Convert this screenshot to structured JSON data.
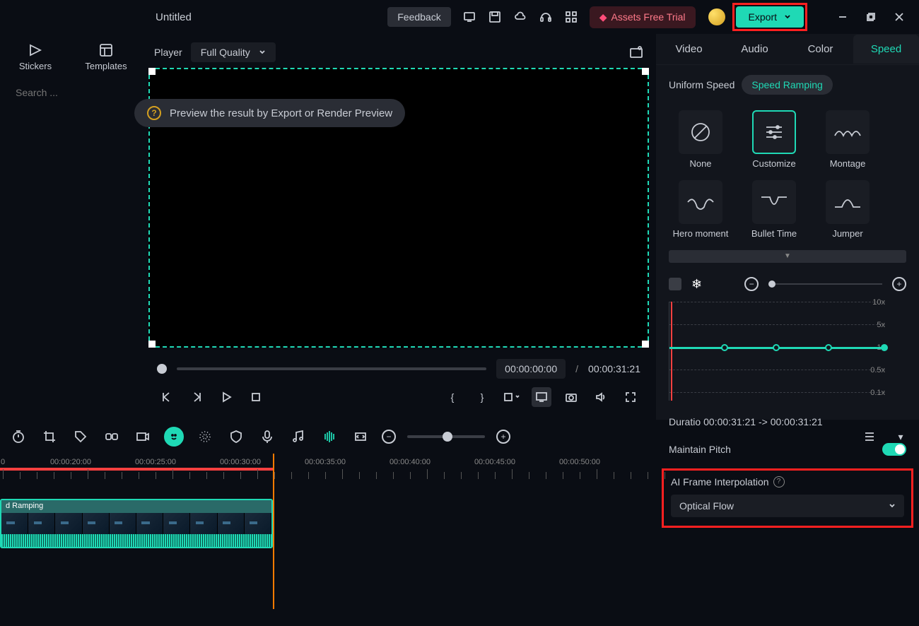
{
  "titlebar": {
    "title": "Untitled",
    "feedback": "Feedback",
    "assets": "Assets Free Trial",
    "export": "Export"
  },
  "sidebar": {
    "tabs": [
      {
        "label": "Stickers"
      },
      {
        "label": "Templates"
      }
    ],
    "search_placeholder": "Search ..."
  },
  "player": {
    "label": "Player",
    "quality": "Full Quality",
    "hint": "Preview the result by Export or Render Preview",
    "current_time": "00:00:00:00",
    "total_time": "00:00:31:21"
  },
  "props": {
    "tabs": [
      "Video",
      "Audio",
      "Color",
      "Speed"
    ],
    "active_tab": "Speed",
    "speed_tabs": [
      "Uniform Speed",
      "Speed Ramping"
    ],
    "active_speed_tab": "Speed Ramping",
    "presets": [
      "None",
      "Customize",
      "Montage",
      "Hero moment",
      "Bullet Time",
      "Jumper"
    ],
    "graph_labels": [
      "10x",
      "5x",
      "1x",
      "0.5x",
      "0.1x"
    ],
    "duration_label": "Duratio",
    "duration_value": "00:00:31:21 -> 00:00:31:21",
    "maintain_pitch": "Maintain Pitch",
    "ai_frame": "AI Frame Interpolation",
    "ai_select": "Optical Flow"
  },
  "timeline": {
    "labels": [
      "0",
      "00:00:20:00",
      "00:00:25:00",
      "00:00:30:00",
      "00:00:35:00",
      "00:00:40:00",
      "00:00:45:00",
      "00:00:50:00"
    ],
    "clip_label": "d Ramping"
  }
}
